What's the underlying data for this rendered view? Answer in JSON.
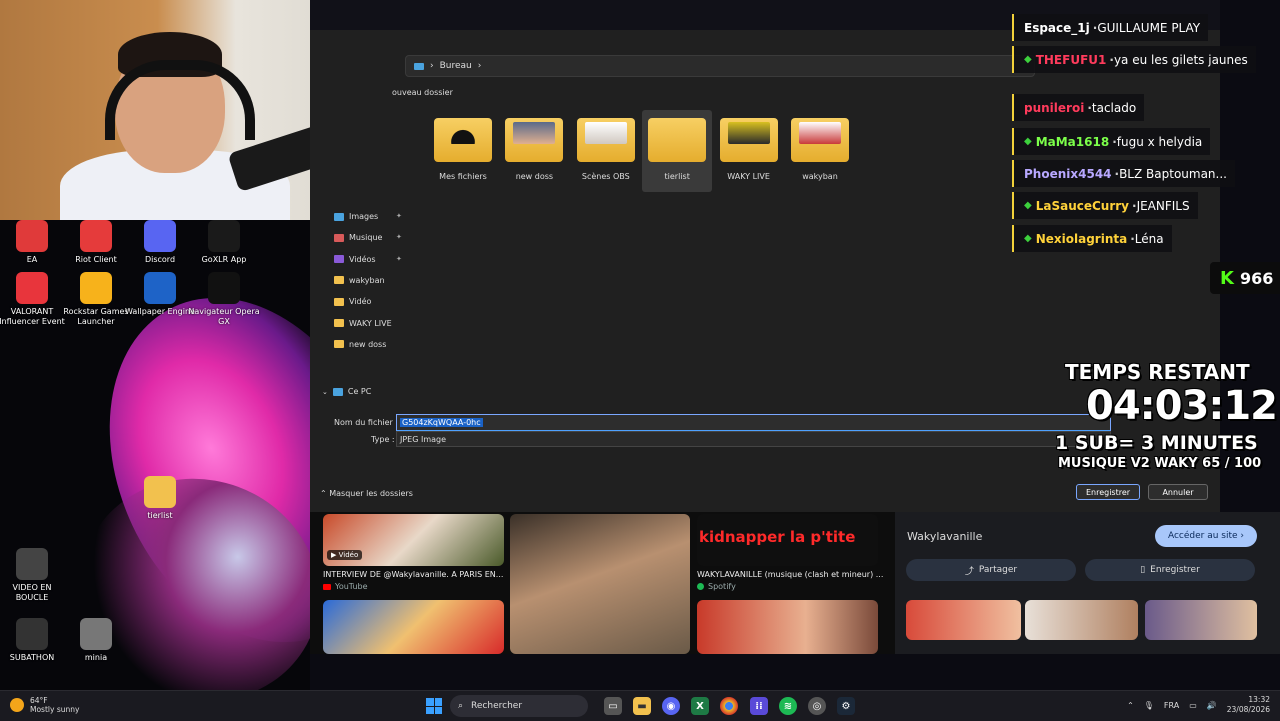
{
  "dialog": {
    "breadcrumb": "Bureau",
    "new_folder": "ouveau dossier",
    "nav_items": [
      "Images",
      "Musique",
      "Vidéos",
      "wakyban",
      "Vidéo",
      "WAKY LIVE",
      "new doss"
    ],
    "this_pc": "Ce PC",
    "folders": [
      "Mes fichiers",
      "new doss",
      "Scènes OBS",
      "tierlist",
      "WAKY LIVE",
      "wakyban"
    ],
    "filename_label": "Nom du fichier :",
    "filename_value": "G504zKqWQAA-0hc",
    "type_label": "Type :",
    "type_value": "JPEG Image",
    "hide_folders": "Masquer les dossiers",
    "save": "Enregistrer",
    "cancel": "Annuler"
  },
  "desktop": {
    "icons": [
      {
        "label": "EA",
        "icon": "ea-icon",
        "color": "#e03a3a"
      },
      {
        "label": "Riot Client",
        "icon": "riot-icon",
        "color": "#e53b3b"
      },
      {
        "label": "Discord",
        "icon": "discord-icon",
        "color": "#5865f2"
      },
      {
        "label": "GoXLR App",
        "icon": "goxlr-icon",
        "color": "#1a1a1a"
      },
      {
        "label": "VALORANT Influencer Event",
        "icon": "valorant-icon",
        "color": "#e8353c"
      },
      {
        "label": "Rockstar Games Launcher",
        "icon": "rockstar-icon",
        "color": "#f7b21b"
      },
      {
        "label": "Wallpaper Engine",
        "icon": "wallpaper-engine-icon",
        "color": "#1e63c7"
      },
      {
        "label": "Navigateur Opera GX",
        "icon": "opera-gx-icon",
        "color": "#111"
      },
      {
        "label": "tierlist",
        "icon": "folder-icon",
        "color": "#f2c14e"
      },
      {
        "label": "VIDEO EN BOUCLE",
        "icon": "video-file-icon",
        "color": "#444"
      },
      {
        "label": "SUBATHON",
        "icon": "text-file-icon",
        "color": "#333"
      },
      {
        "label": "minia",
        "icon": "image-file-icon",
        "color": "#777"
      }
    ]
  },
  "results": {
    "video_badge": "Vidéo",
    "items": [
      {
        "title": "INTERVIEW DE @Wakylavanille. A PARIS EN...",
        "source": "YouTube"
      },
      {
        "title": "WAKYLAVANILLE (musique (clash et mineur) ...",
        "source": "Spotify"
      }
    ],
    "thumb_text": "kidnapper la p'tite",
    "panel": {
      "title": "Wakylavanille",
      "visit": "Accéder au site",
      "share": "Partager",
      "save": "Enregistrer"
    }
  },
  "chat": [
    {
      "user": "Espace_1j",
      "msg": "GUILLAUME PLAY",
      "color": "#ffffff"
    },
    {
      "user": "THEFUFU1",
      "msg": "ya eu les gilets jaunes",
      "color": "#ff3b5c"
    },
    {
      "user": "punileroi",
      "msg": "taclado",
      "color": "#ff3b5c"
    },
    {
      "user": "MaMa1618",
      "msg": "fugu x helydia",
      "color": "#7cff4a"
    },
    {
      "user": "Phoenix4544",
      "msg": "BLZ Baptouman...",
      "color": "#b8a8ff"
    },
    {
      "user": "LaSauceCurry",
      "msg": "JEANFILS",
      "color": "#ffd23a"
    },
    {
      "user": "Nexiolagrinta",
      "msg": "Léna",
      "color": "#ffd23a"
    }
  ],
  "kick_count": "966",
  "overlay": {
    "line1": "TEMPS RESTANT",
    "timer": "04:03:12",
    "line3": "1 SUB= 3 MINUTES",
    "line4": "MUSIQUE V2 WAKY 65 / 100"
  },
  "taskbar": {
    "temp": "64°F",
    "weather": "Mostly sunny",
    "search": "Rechercher",
    "lang": "FRA",
    "time": "13:32",
    "date": "23/08/2026"
  }
}
